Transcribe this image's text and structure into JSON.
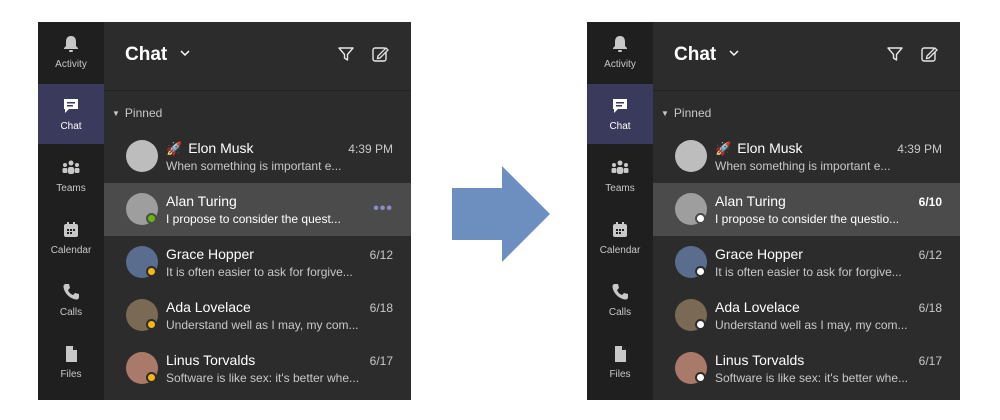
{
  "nav": [
    {
      "label": "Activity",
      "icon": "bell-icon"
    },
    {
      "label": "Chat",
      "icon": "chat-icon"
    },
    {
      "label": "Teams",
      "icon": "teams-icon"
    },
    {
      "label": "Calendar",
      "icon": "calendar-icon"
    },
    {
      "label": "Calls",
      "icon": "phone-icon"
    },
    {
      "label": "Files",
      "icon": "file-icon"
    }
  ],
  "header": {
    "title": "Chat"
  },
  "pinned_label": "Pinned",
  "before": {
    "active_nav": "Chat",
    "selected_chat": "Alan Turing",
    "chats": [
      {
        "name": "Elon Musk",
        "prefix_icon": "rocket-icon",
        "time": "4:39 PM",
        "preview": "When something is important e...",
        "status": "none",
        "avatar_color": "#bdbdbd"
      },
      {
        "name": "Alan Turing",
        "time": "",
        "preview": "I propose to consider the quest...",
        "status": "available",
        "avatar_color": "#9e9e9e"
      },
      {
        "name": "Grace Hopper",
        "time": "6/12",
        "preview": "It is often easier to ask for forgive...",
        "status": "away",
        "avatar_color": "#5a6d8f"
      },
      {
        "name": "Ada Lovelace",
        "time": "6/18",
        "preview": "Understand well as I may, my com...",
        "status": "away",
        "avatar_color": "#7a6a55"
      },
      {
        "name": "Linus Torvalds",
        "time": "6/17",
        "preview": "Software is like sex: it's better whe...",
        "status": "away",
        "avatar_color": "#a97a6a"
      }
    ]
  },
  "after": {
    "active_nav": "Chat",
    "selected_chat": "Alan Turing",
    "chats": [
      {
        "name": "Elon Musk",
        "prefix_icon": "rocket-icon",
        "time": "4:39 PM",
        "preview": "When something is important e...",
        "status": "none",
        "avatar_color": "#bdbdbd"
      },
      {
        "name": "Alan Turing",
        "time": "6/10",
        "preview": "I propose to consider the questio...",
        "status": "offline",
        "avatar_color": "#9e9e9e"
      },
      {
        "name": "Grace Hopper",
        "time": "6/12",
        "preview": "It is often easier to ask for forgive...",
        "status": "offline",
        "avatar_color": "#5a6d8f"
      },
      {
        "name": "Ada Lovelace",
        "time": "6/18",
        "preview": "Understand well as I may, my com...",
        "status": "offline",
        "avatar_color": "#7a6a55"
      },
      {
        "name": "Linus Torvalds",
        "time": "6/17",
        "preview": "Software is like sex: it's better whe...",
        "status": "offline",
        "avatar_color": "#a97a6a"
      }
    ]
  },
  "colors": {
    "panel": "#2d2c2c",
    "rail": "#1f1f1f",
    "rail_active": "#3a3a5c",
    "row_selected": "#4b4b4b",
    "arrow": "#6d8fbf",
    "status_available": "#6bb700",
    "status_away": "#f8b70d",
    "status_offline": "#ffffff",
    "more_dots": "#8b8cc7"
  }
}
